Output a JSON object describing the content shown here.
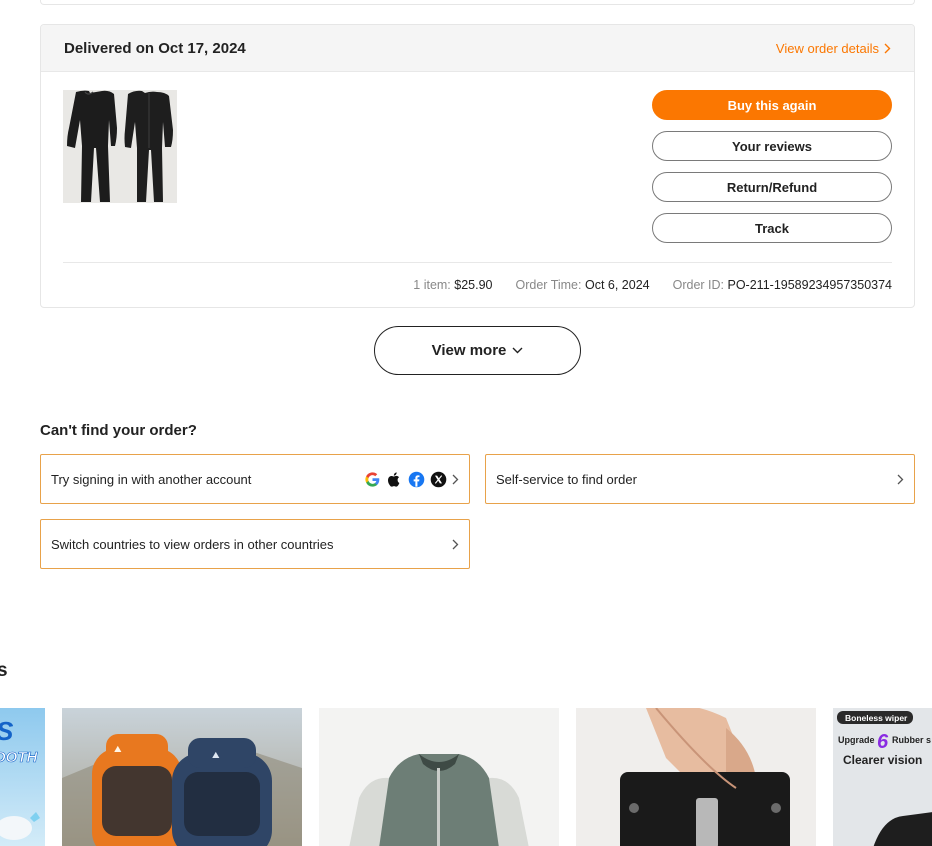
{
  "order": {
    "status": "Delivered on Oct 17, 2024",
    "view_details": "View order details",
    "actions": {
      "buy_again": "Buy this again",
      "reviews": "Your reviews",
      "return_refund": "Return/Refund",
      "track": "Track"
    },
    "meta": {
      "items_label": "1 item:",
      "items_value": "$25.90",
      "time_label": "Order Time:",
      "time_value": "Oct 6, 2024",
      "id_label": "Order ID:",
      "id_value": "PO-211-19589234957350374"
    }
  },
  "view_more": "View more",
  "help": {
    "title": "Can't find your order?",
    "options": [
      {
        "label": "Try signing in with another account"
      },
      {
        "label": "Self-service to find order"
      },
      {
        "label": "Switch countries to view orders in other countries"
      }
    ],
    "social_icons": [
      "google-icon",
      "apple-icon",
      "facebook-icon",
      "x-icon"
    ]
  },
  "recommendations": {
    "title_fragment": "s",
    "items": [
      {
        "image": "bluetooth-product-image",
        "overlay_text_1": "S",
        "overlay_text_2": "OOTH"
      },
      {
        "image": "hiking-backpacks-image"
      },
      {
        "image": "bomber-jacket-image"
      },
      {
        "image": "card-holder-wallet-image"
      },
      {
        "image": "wiper-blade-image",
        "badge": "Boneless wiper",
        "line1_a": "Upgrade",
        "line1_num": "6",
        "line1_b": "Rubber s",
        "line2": "Clearer vision"
      }
    ]
  },
  "colors": {
    "accent": "#fb7701",
    "help_border": "#e8a24a"
  }
}
